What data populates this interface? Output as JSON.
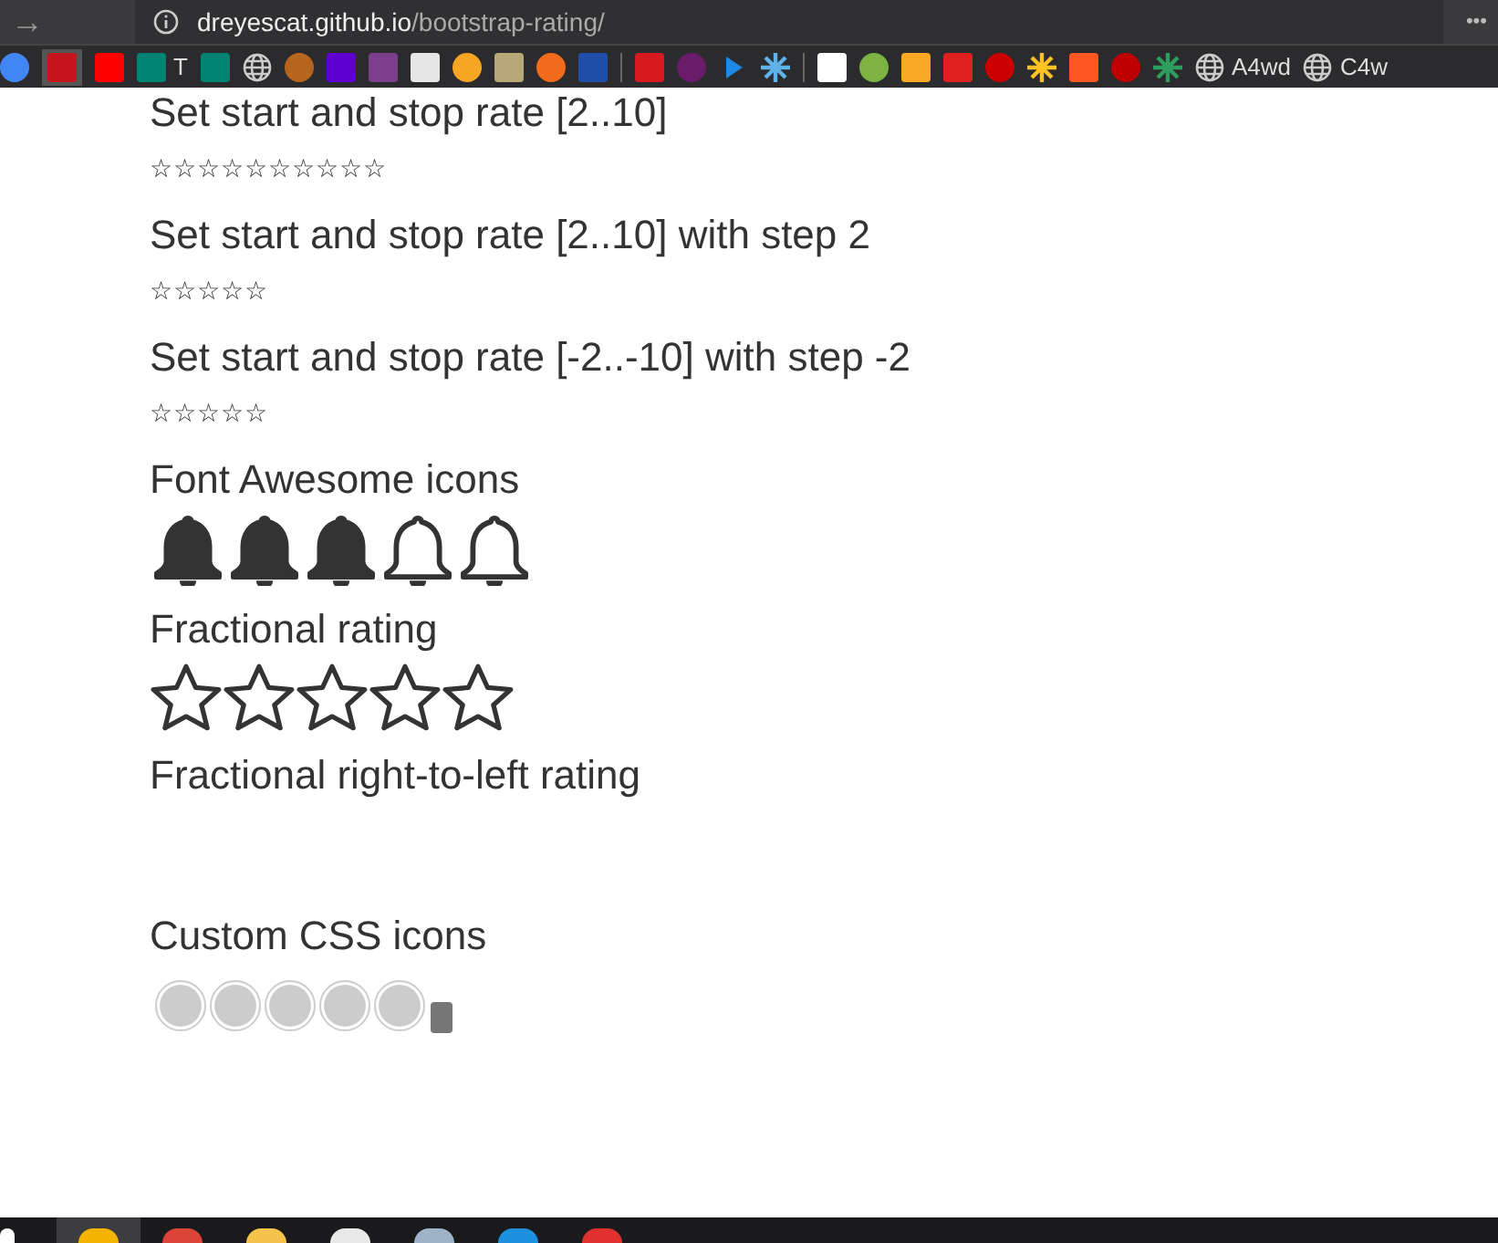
{
  "browser": {
    "forward": "→",
    "url_host": "dreyescat.github.io",
    "url_path": "/bootstrap-rating/",
    "menu": "•••",
    "bookmarks": [
      {
        "kind": "circle",
        "color": "#4285f4"
      },
      {
        "kind": "square",
        "color": "#c4161c",
        "selected": true
      },
      {
        "kind": "square",
        "color": "#ff0000"
      },
      {
        "kind": "square",
        "color": "#008373",
        "label": "T"
      },
      {
        "kind": "square",
        "color": "#008373"
      },
      {
        "kind": "globe",
        "color": "#cccccc"
      },
      {
        "kind": "circle",
        "color": "#b5651d"
      },
      {
        "kind": "square",
        "color": "#5f01d1"
      },
      {
        "kind": "square",
        "color": "#7b3f8c"
      },
      {
        "kind": "square",
        "color": "#e6e6e6"
      },
      {
        "kind": "circle",
        "color": "#f5a623"
      },
      {
        "kind": "square",
        "color": "#b8a878"
      },
      {
        "kind": "circle",
        "color": "#f26b1d"
      },
      {
        "kind": "square",
        "color": "#1f4fa8"
      },
      {
        "kind": "separator",
        "color": "#666666"
      },
      {
        "kind": "square",
        "color": "#d71920"
      },
      {
        "kind": "circle",
        "color": "#6a1b6a"
      },
      {
        "kind": "triangle",
        "color": "#1e88e5"
      },
      {
        "kind": "star",
        "color": "#5fb3e8"
      },
      {
        "kind": "separator",
        "color": "#666666"
      },
      {
        "kind": "square",
        "color": "#ffffff"
      },
      {
        "kind": "circle",
        "color": "#7cb342"
      },
      {
        "kind": "square",
        "color": "#f9a825"
      },
      {
        "kind": "square",
        "color": "#e01f1f"
      },
      {
        "kind": "circle",
        "color": "#cc0000"
      },
      {
        "kind": "star",
        "color": "#ffc220"
      },
      {
        "kind": "square",
        "color": "#ff5722"
      },
      {
        "kind": "circle",
        "color": "#bf0000"
      },
      {
        "kind": "star",
        "color": "#2e9e5e"
      },
      {
        "kind": "globe",
        "color": "#cccccc",
        "label": "A4wd"
      },
      {
        "kind": "globe",
        "color": "#cccccc",
        "label": "C4w"
      }
    ]
  },
  "sections": [
    {
      "title": "Set start and stop rate [2..10]",
      "rating": {
        "kind": "glyph",
        "stars": 0,
        "text": "☆☆☆☆☆☆☆☆☆☆"
      }
    },
    {
      "title": "Set start and stop rate [2..10] with step 2",
      "rating": {
        "kind": "glyph",
        "stars": 0,
        "text": "☆☆☆☆☆"
      }
    },
    {
      "title": "Set start and stop rate [-2..-10] with step -2",
      "rating": {
        "kind": "glyph",
        "stars": 0,
        "text": "☆☆☆☆☆"
      }
    },
    {
      "title": "Font Awesome icons",
      "rating": {
        "kind": "bell",
        "items": [
          {
            "filled": true
          },
          {
            "filled": true
          },
          {
            "filled": true
          },
          {
            "filled": false
          },
          {
            "filled": false
          }
        ]
      }
    },
    {
      "title": "Fractional rating",
      "rating": {
        "kind": "star",
        "items": [
          {
            "filled": false
          },
          {
            "filled": false
          },
          {
            "filled": false
          },
          {
            "filled": false
          },
          {
            "filled": false
          }
        ]
      }
    },
    {
      "title": "Fractional right-to-left rating",
      "rating": {
        "kind": "empty"
      }
    },
    {
      "title": "Custom CSS icons",
      "rating": {
        "kind": "circle",
        "items": [
          {
            "filled": false
          },
          {
            "filled": false
          },
          {
            "filled": false
          },
          {
            "filled": false
          },
          {
            "filled": false
          }
        ]
      }
    }
  ],
  "taskbar": [
    {
      "color": "#ffffff",
      "selected": false
    },
    {
      "color": "#f4b400",
      "selected": true
    },
    {
      "color": "#db4437",
      "selected": false
    },
    {
      "color": "#f6c34a",
      "selected": false
    },
    {
      "color": "#e8e8e8",
      "selected": false
    },
    {
      "color": "#9fb3c8",
      "selected": false
    },
    {
      "color": "#1e90e0",
      "selected": false
    },
    {
      "color": "#e03030",
      "selected": false
    }
  ]
}
